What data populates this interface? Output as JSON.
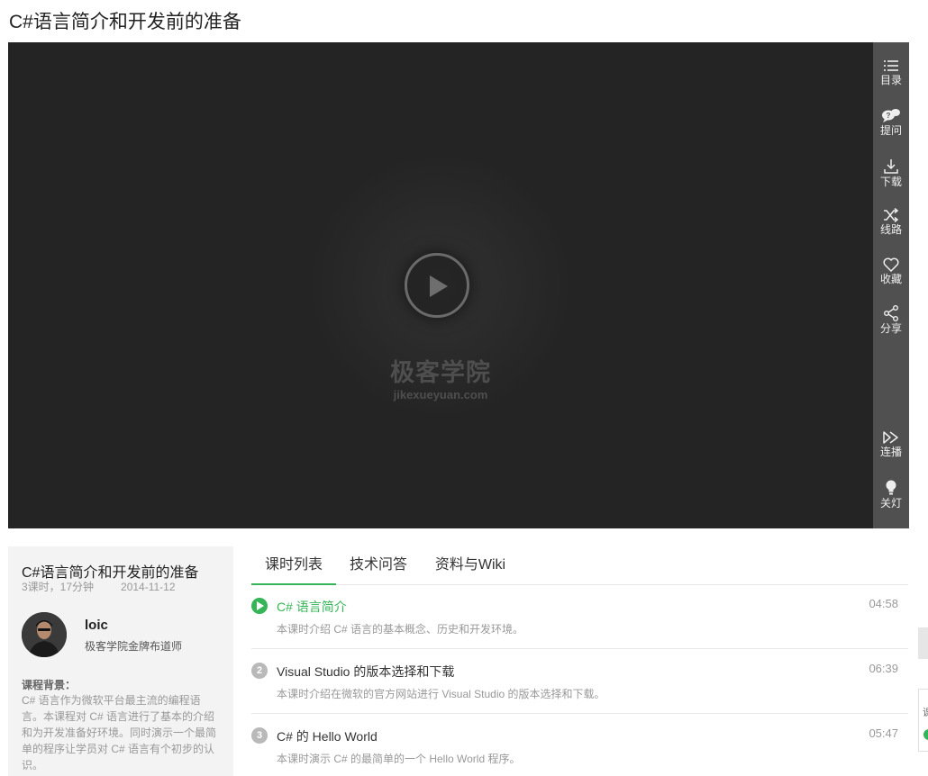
{
  "page": {
    "title": "C#语言简介和开发前的准备"
  },
  "player": {
    "watermark_cn": "极客学院",
    "watermark_en": "jikexueyuan.com"
  },
  "sidebar": {
    "items": [
      {
        "label": "目录",
        "icon": "list-icon"
      },
      {
        "label": "提问",
        "icon": "question-bubble-icon"
      },
      {
        "label": "下载",
        "icon": "download-icon"
      },
      {
        "label": "线路",
        "icon": "shuffle-icon"
      },
      {
        "label": "收藏",
        "icon": "heart-icon"
      },
      {
        "label": "分享",
        "icon": "share-icon"
      },
      {
        "label": "连播",
        "icon": "autoplay-icon"
      },
      {
        "label": "关灯",
        "icon": "bulb-icon"
      }
    ]
  },
  "course": {
    "title": "C#语言简介和开发前的准备",
    "meta": "3课时，17分钟",
    "date": "2014-11-12",
    "teacher_name": "loic",
    "teacher_title": "极客学院金牌布道师",
    "background_label": "课程背景：",
    "background_text": "C# 语言作为微软平台最主流的编程语言。本课程对 C# 语言进行了基本的介绍和为开发准备好环境。同时演示一个最简单的程序让学员对 C# 语言有个初步的认识。"
  },
  "tabs": [
    {
      "label": "课时列表",
      "active": true
    },
    {
      "label": "技术问答",
      "active": false
    },
    {
      "label": "资料与Wiki",
      "active": false
    }
  ],
  "lessons": [
    {
      "number": "1",
      "title": "C# 语言简介",
      "desc": "本课时介绍 C# 语言的基本概念、历史和开发环境。",
      "duration": "04:58",
      "active": true
    },
    {
      "number": "2",
      "title": "Visual Studio 的版本选择和下载",
      "desc": "本课时介绍在微软的官方网站进行 Visual Studio 的版本选择和下载。",
      "duration": "06:39",
      "active": false
    },
    {
      "number": "3",
      "title": "C# 的 Hello World",
      "desc": "本课时演示 C# 的最简单的一个 Hello World 程序。",
      "duration": "05:47",
      "active": false
    }
  ],
  "edge": {
    "char": "课"
  },
  "colors": {
    "accent": "#35b558",
    "player_bg": "#242424",
    "sidebar_bg": "#505050"
  }
}
